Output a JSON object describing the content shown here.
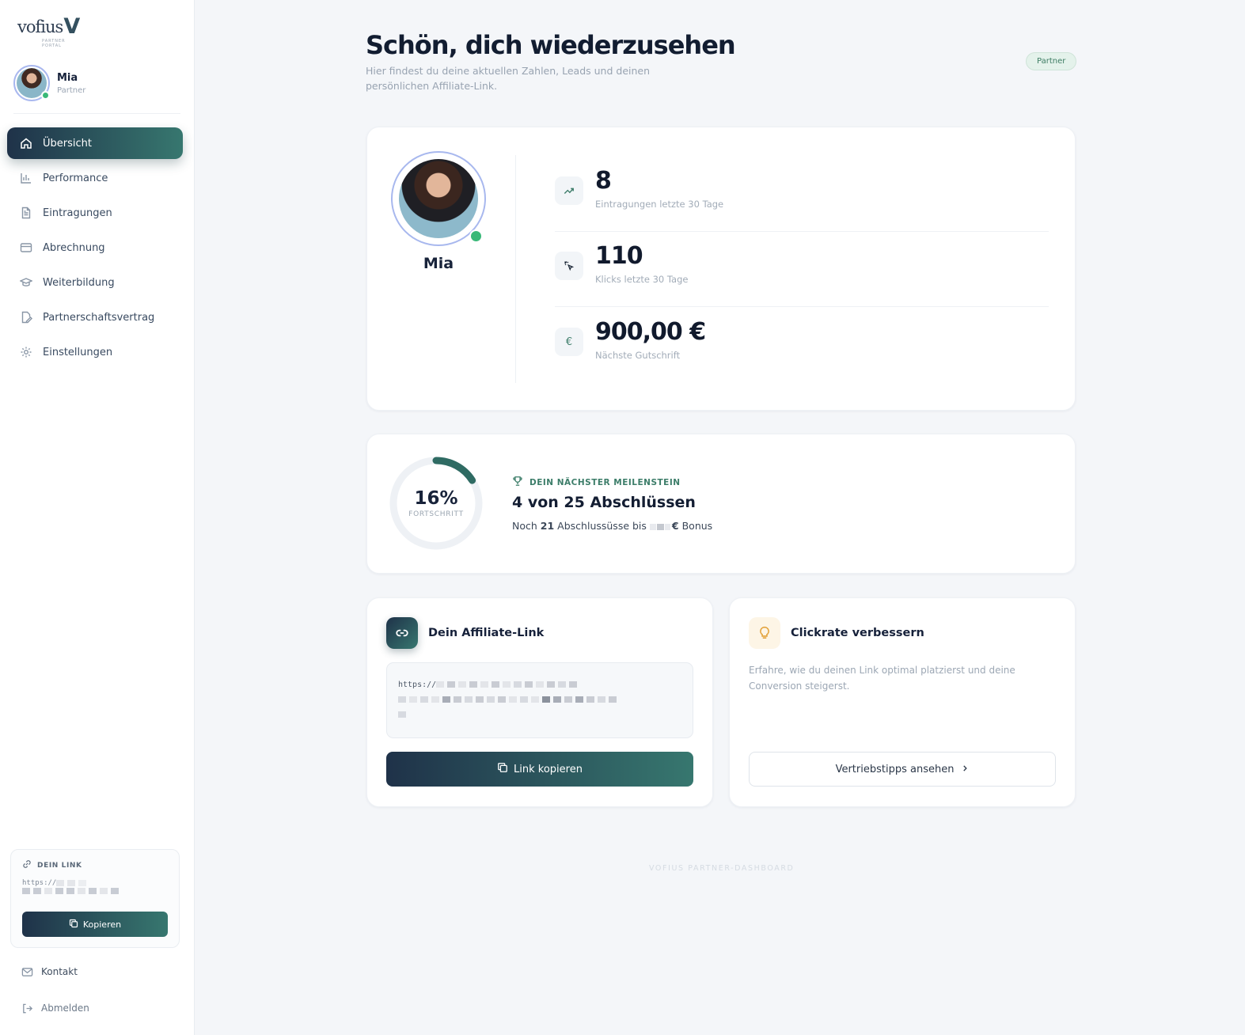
{
  "brand": {
    "logo_word": "vofius",
    "logo_mark": "V",
    "logo_tag": "PARTNER PORTAL"
  },
  "user": {
    "name": "Mia",
    "role": "Partner"
  },
  "nav": {
    "items": [
      {
        "label": "Übersicht",
        "icon": "home-icon",
        "active": true
      },
      {
        "label": "Performance",
        "icon": "bar-chart-icon"
      },
      {
        "label": "Eintragungen",
        "icon": "document-icon"
      },
      {
        "label": "Abrechnung",
        "icon": "credit-card-icon"
      },
      {
        "label": "Weiterbildung",
        "icon": "graduation-cap-icon"
      },
      {
        "label": "Partnerschaftsvertrag",
        "icon": "contract-edit-icon"
      },
      {
        "label": "Einstellungen",
        "icon": "gear-icon"
      }
    ]
  },
  "sidebar_link": {
    "title": "DEIN LINK",
    "url_prefix": "https://",
    "copy_label": "Kopieren"
  },
  "footer_links": {
    "contact": "Kontakt",
    "logout": "Abmelden"
  },
  "header": {
    "title": "Schön, dich wiederzusehen",
    "subtitle": "Hier findest du deine aktuellen Zahlen, Leads und deinen persönlichen Affiliate-Link.",
    "badge": "Partner"
  },
  "profile_card": {
    "name": "Mia"
  },
  "stats": [
    {
      "value": "8",
      "label": "Eintragungen letzte 30 Tage",
      "icon": "trending-up-icon"
    },
    {
      "value": "110",
      "label": "Klicks letzte 30 Tage",
      "icon": "cursor-click-icon"
    },
    {
      "value": "900,00 €",
      "label": "Nächste Gutschrift",
      "icon": "euro-icon"
    }
  ],
  "milestone": {
    "progress_percent": 16,
    "progress_text": "16%",
    "progress_label": "FORTSCHRITT",
    "heading": "DEIN NÄCHSTER MEILENSTEIN",
    "title": "4 von 25 Abschlüssen",
    "sub_prefix": "Noch",
    "sub_count": "21",
    "sub_middle": "Abschlussüsse bis",
    "sub_currency": "€",
    "sub_suffix": "Bonus"
  },
  "affiliate": {
    "title": "Dein Affiliate-Link",
    "url_prefix": "https://",
    "copy_label": "Link kopieren"
  },
  "tips": {
    "title": "Clickrate verbessern",
    "text": "Erfahre, wie du deinen Link optimal platzierst und deine Conversion steigerst.",
    "button": "Vertriebstipps ansehen"
  },
  "footer": {
    "text": "VOFIUS PARTNER-DASHBOARD"
  },
  "colors": {
    "accent": "#37776f",
    "navy": "#1f3249",
    "online": "#39b878",
    "ring": "#a8b8ee"
  }
}
